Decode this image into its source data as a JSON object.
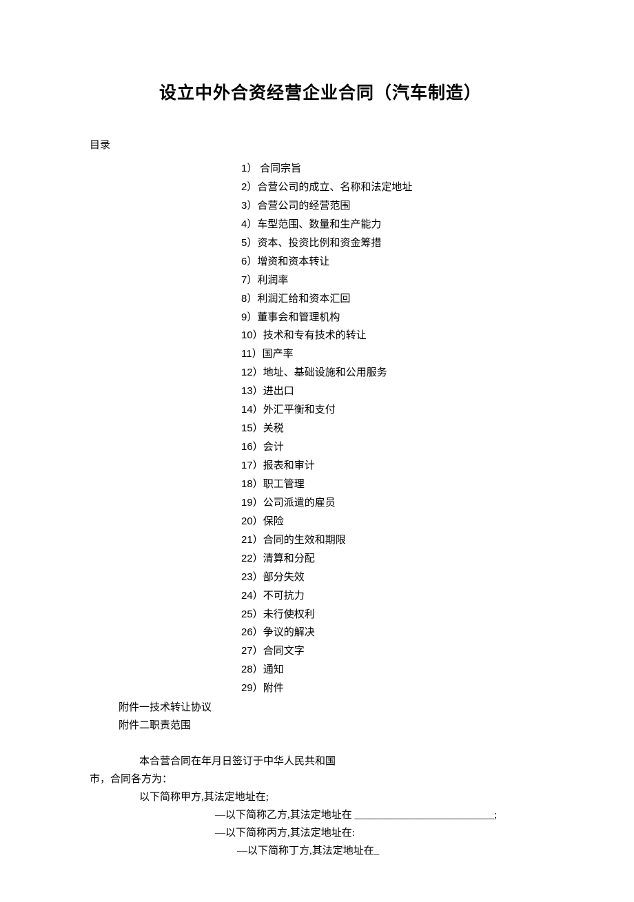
{
  "title": "设立中外合资经营企业合同（汽车制造）",
  "toc_heading": "目录",
  "toc": [
    {
      "num": "1）",
      "label": " 合同宗旨"
    },
    {
      "num": "2）",
      "label": "合营公司的成立、名称和法定地址"
    },
    {
      "num": "3）",
      "label": "合营公司的经营范围"
    },
    {
      "num": "4）",
      "label": "车型范围、数量和生产能力"
    },
    {
      "num": "5）",
      "label": "资本、投资比例和资金筹措"
    },
    {
      "num": "6）",
      "label": "增资和资本转让"
    },
    {
      "num": "7）",
      "label": "利润率"
    },
    {
      "num": "8）",
      "label": "利润汇给和资本汇回"
    },
    {
      "num": "9）",
      "label": "董事会和管理机构"
    },
    {
      "num": "10）",
      "label": "技术和专有技术的转让"
    },
    {
      "num": "11）",
      "label": "国产率"
    },
    {
      "num": "12）",
      "label": "地址、基础设施和公用服务"
    },
    {
      "num": "13）",
      "label": "进出口"
    },
    {
      "num": "14）",
      "label": "外汇平衡和支付"
    },
    {
      "num": "15）",
      "label": "关税"
    },
    {
      "num": "16）",
      "label": "会计"
    },
    {
      "num": "17）",
      "label": "报表和审计"
    },
    {
      "num": "18）",
      "label": "职工管理"
    },
    {
      "num": "19）",
      "label": "公司派遣的雇员"
    },
    {
      "num": "20）",
      "label": "保险"
    },
    {
      "num": "21）",
      "label": "合同的生效和期限"
    },
    {
      "num": "22）",
      "label": "清算和分配"
    },
    {
      "num": "23）",
      "label": "部分失效"
    },
    {
      "num": "24）",
      "label": "不可抗力"
    },
    {
      "num": "25）",
      "label": "未行使权利"
    },
    {
      "num": "26）",
      "label": "争议的解决"
    },
    {
      "num": "27）",
      "label": "合同文字"
    },
    {
      "num": "28）",
      "label": "通知"
    },
    {
      "num": "29）",
      "label": "附件"
    }
  ],
  "appendix": [
    "附件一技术转让协议",
    "附件二职责范围"
  ],
  "body": {
    "line1": "本合营合同在年月日签订于中华人民共和国",
    "line2": "市，合同各方为：",
    "line3": "以下简称甲方,其法定地址在;",
    "line4_prefix": "—以下简称乙方,其法定地址在 ",
    "line4_blank": "___________________________",
    "line4_suffix": ";",
    "line5": "—以下简称丙方,其法定地址在:",
    "line6": "—以下简称丁方,其法定地址在_"
  }
}
